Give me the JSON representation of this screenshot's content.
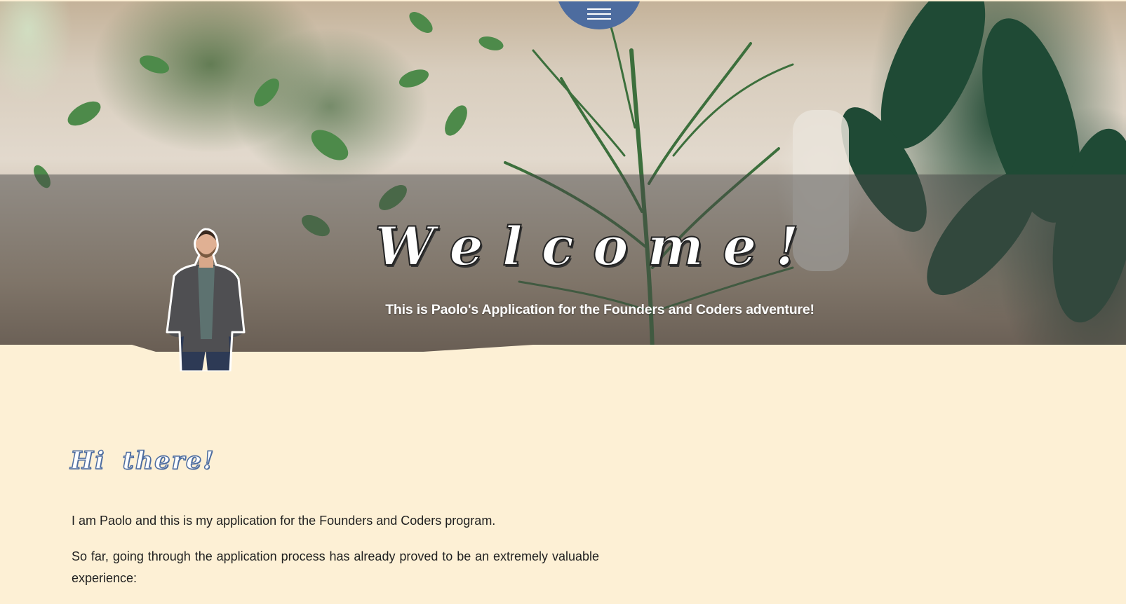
{
  "nav": {
    "menu_icon": "hamburger-icon"
  },
  "hero": {
    "title": "Welcome!",
    "subtitle": "This is Paolo's Application for the Founders and Coders adventure!"
  },
  "intro": {
    "heading": "Hi there!",
    "paragraphs": [
      "I am Paolo and this is my application for the Founders and Coders program.",
      "So far, going through the application process has already proved to be an extremely valuable experience:"
    ]
  },
  "colors": {
    "accent": "#4d6c9f",
    "page_background": "#fdf0d5",
    "hero_band": "rgba(70,70,70,0.5)",
    "text": "#1f1f1f"
  }
}
